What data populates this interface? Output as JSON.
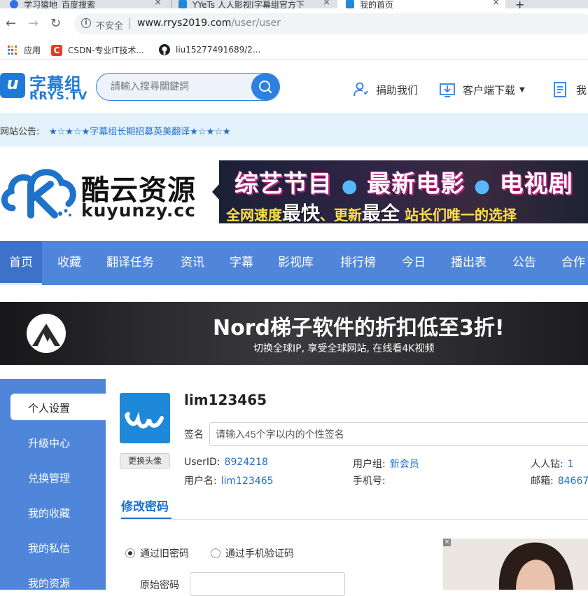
{
  "browser": {
    "tabs": [
      {
        "title": "学习猿地_百度搜索"
      },
      {
        "title": "YYeTs 人人影视|字幕组官方下载"
      },
      {
        "title": "我的首页"
      }
    ],
    "new_tab_label": "+",
    "address": {
      "security_label": "不安全",
      "url_host": "www.rrys2019.com",
      "url_path": "/user/user"
    },
    "bookmarks": [
      {
        "label": "应用"
      },
      {
        "label": "CSDN-专业IT技术..."
      },
      {
        "label": "liu15277491689/2..."
      }
    ]
  },
  "header": {
    "logo_cn": "字幕组",
    "logo_en": "RRYS.TV",
    "search_placeholder": "請輸入搜尋關鍵詞",
    "links": [
      {
        "label": "捐助我们"
      },
      {
        "label": "客户端下载"
      },
      {
        "label": "我"
      }
    ]
  },
  "notice": {
    "label": "网站公告:",
    "text": "★☆★☆★字幕组长期招募英美翻译★☆★☆★"
  },
  "banner1": {
    "brand_cn": "酷云资源",
    "brand_en": "kuyunzy.cc",
    "line1": [
      "综艺节目",
      "最新电影",
      "电视剧"
    ],
    "line2_a": "全网速度",
    "line2_b": "最快",
    "line2_c": "、更新",
    "line2_d": "最全",
    "line2_e": " 站长们唯一的选择"
  },
  "nav": {
    "items": [
      {
        "label": "首页"
      },
      {
        "label": "收藏"
      },
      {
        "label": "翻译任务"
      },
      {
        "label": "资讯"
      },
      {
        "label": "字幕"
      },
      {
        "label": "影视库"
      },
      {
        "label": "排行榜"
      },
      {
        "label": "今日"
      },
      {
        "label": "播出表"
      },
      {
        "label": "公告"
      },
      {
        "label": "合作"
      }
    ]
  },
  "banner2": {
    "headline": "Nord梯子软件的折扣低至3折!",
    "subline": "切换全球IP, 享受全球网站, 在线看4K视频"
  },
  "sidebar": {
    "items": [
      {
        "label": "个人设置"
      },
      {
        "label": "升级中心"
      },
      {
        "label": "兑换管理"
      },
      {
        "label": "我的收藏"
      },
      {
        "label": "我的私信"
      },
      {
        "label": "我的资源"
      }
    ]
  },
  "profile": {
    "username": "lim123465",
    "change_avatar": "更换头像",
    "signature_label": "签名",
    "signature_placeholder": "请输入45个字以内的个性签名",
    "userid_label": "UserID:",
    "userid": "8924218",
    "group_label": "用户组:",
    "group": "新会员",
    "diamond_label": "人人钻:",
    "diamond": "1",
    "name_label": "用户名:",
    "name": "lim123465",
    "phone_label": "手机号:",
    "phone": "",
    "email_label": "邮箱:",
    "email": "84667"
  },
  "password": {
    "tab": "修改密码",
    "option_old": "通过旧密码",
    "option_phone": "通过手机验证码",
    "old_label": "原始密码"
  },
  "colors": {
    "brand_blue": "#1f7ad6",
    "nav_blue": "#4f86d9",
    "link_blue": "#1f6fc9",
    "notice_bg": "#e3f1fa"
  }
}
